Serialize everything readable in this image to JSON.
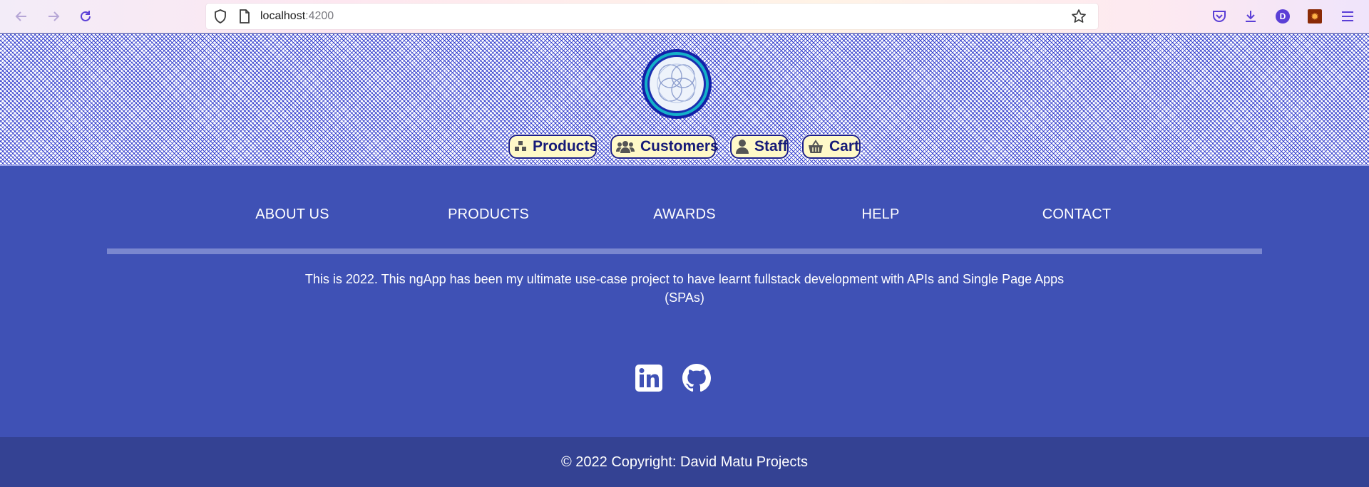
{
  "browser": {
    "url_host": "localhost",
    "url_port": ":4200",
    "profile_initial": "D",
    "icons": [
      "back-arrow-icon",
      "forward-arrow-icon",
      "reload-icon",
      "shield-icon",
      "page-icon",
      "star-icon",
      "pocket-icon",
      "download-icon",
      "extension-icon",
      "hamburger-menu-icon"
    ]
  },
  "header": {
    "nav": [
      {
        "label": "Products",
        "icon": "products-icon"
      },
      {
        "label": "Customers",
        "icon": "customers-icon"
      },
      {
        "label": "Staff",
        "icon": "staff-icon"
      },
      {
        "label": "Cart",
        "icon": "cart-icon"
      }
    ],
    "colors": {
      "button_bg": "#fff9c8",
      "button_text": "#161a78",
      "pattern": "#1e2ac8"
    }
  },
  "footer": {
    "links": [
      "ABOUT US",
      "PRODUCTS",
      "AWARDS",
      "HELP",
      "CONTACT"
    ],
    "blurb_line1": "This is 2022. This ngApp has been my ultimate use-case project to have learnt fullstack development with APIs and Single Page Apps",
    "blurb_line2": "(SPAs)",
    "social": [
      "linkedin-icon",
      "github-icon"
    ],
    "copyright": "© 2022 Copyright: David Matu Projects",
    "colors": {
      "background": "#3f51b5",
      "bottom_bar": "#344293",
      "divider": "#7a87cf"
    }
  }
}
